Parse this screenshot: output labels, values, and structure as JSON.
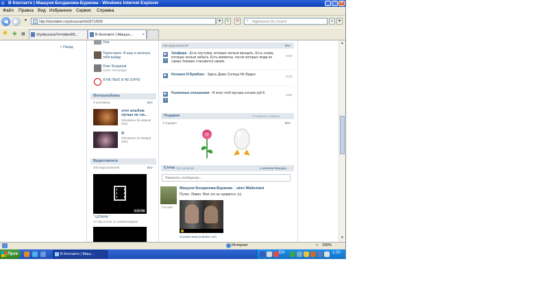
{
  "window": {
    "title": "В Контакте | Машуня Богданова-Буркова - Windows Internet Explorer",
    "controls": {
      "minimize": "_",
      "maximize": "□",
      "close": "×"
    }
  },
  "menu": [
    "Файл",
    "Правка",
    "Вид",
    "Избранное",
    "Сервис",
    "Справка"
  ],
  "address": {
    "url": "http://vkontakte.ru/yokozuna#/id18713008",
    "search_placeholder": "Nightwaves.Ru Search"
  },
  "tabs": [
    {
      "label": "#/yokozuna?z=video69...",
      "active": false
    },
    {
      "label": "В Контакте | Машун...",
      "active": true
    }
  ],
  "page": {
    "back_link": "« Назад",
    "friends": [
      {
        "name": "Они",
        "sub": ""
      },
      {
        "name": "Терли меня. Я еще и заночую тебя выйду.",
        "sub": ""
      },
      {
        "name": "Олег Богданов",
        "sub": "Санкт-Петербург"
      },
      {
        "name": "Я НЕ ПЬЮ И НЕ КУРЮ",
        "sub": ""
      }
    ],
    "photo_albums": {
      "header": "Фотоальбомы",
      "count": "9 альбомов",
      "all": "Все",
      "items": [
        {
          "title": "этот альбом лучше не см...",
          "updated": "Обновлен 26 апреля 2011"
        },
        {
          "title": "Я",
          "updated": "Обновлен 24 января 2011"
        }
      ]
    },
    "videos": {
      "header": "Видеозаписи",
      "count": "406 видеозаписей",
      "all": "Все",
      "item": {
        "duration": "1:27:36",
        "title": "\" ШПАНА \"",
        "meta": "17 апр в 0:45 | 5 комментариев"
      }
    },
    "audio": {
      "count": "139 аудиозаписей",
      "all": "Все",
      "tracks": [
        {
          "artist": "Зенфира",
          "title": "Есть поступки, которые нельзя прощать. Есть слова, которые нельзя забыть. Есть моменты, после которых люди из самых близких становятся никем.",
          "duration": "4:04"
        },
        {
          "artist": "Ноганно И Бумбокс",
          "title": "Здесь Даже Солнца Не Видно",
          "duration": "4:13"
        },
        {
          "artist": "Рыночные отношения",
          "title": "Я хочу чтоб мусора сосали хуй Е",
          "duration": "2:03"
        }
      ]
    },
    "gifts": {
      "header": "Подарки",
      "send": "Отправить подарок",
      "count": "2 подарка",
      "all": "Все"
    },
    "wall": {
      "header": "Стена",
      "count": "513 записей",
      "to_posts": "к записям Машуни",
      "input_placeholder": "Написать сообщение...",
      "post": {
        "author": "Машуня Богданова-Буркова",
        "arrow": "□",
        "to": "aton Wallestani",
        "text": "Путин. Ливия. Мне это не нравится. (c)",
        "online": "Онлайн",
        "link": "Ссылка www.youtube.com"
      }
    }
  },
  "statusbar": {
    "zone": "Интернет",
    "zoom": "100%"
  },
  "taskbar": {
    "start": "Пуск",
    "task": "В Контакте | Маш...",
    "lang": "EN",
    "clock": "1:20"
  },
  "colors": {
    "titlebar": "#0a3fb5",
    "link": "#2b587a",
    "section_bg": "#e1e7ed"
  }
}
